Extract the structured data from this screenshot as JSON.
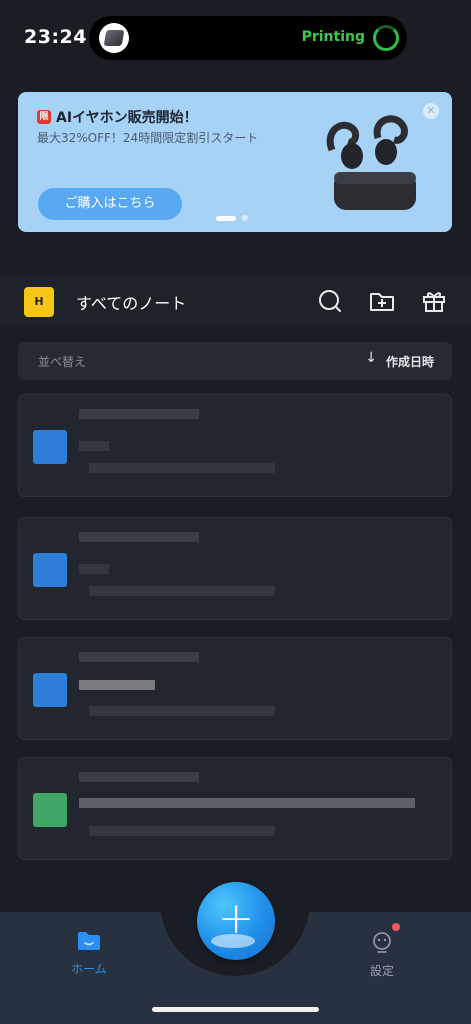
{
  "status_bar": {
    "time": "23:24",
    "live_activity_label": "Printing"
  },
  "banner": {
    "badge": "限",
    "title": "AIイヤホン販売開始！",
    "subtitle": "最大32%OFF！24時間限定割引スタート",
    "cta": "ご購入はこちら",
    "close": "✕"
  },
  "header": {
    "logo_letter": "H",
    "title": "すべてのノート"
  },
  "sort": {
    "label": "並べ替え",
    "arrow": "↓",
    "value": "作成日時"
  },
  "notes": [
    {
      "thumb_color": "#2e7fd9"
    },
    {
      "thumb_color": "#2e7fd9"
    },
    {
      "thumb_color": "#2e7fd9"
    },
    {
      "thumb_color": "#3fa866"
    }
  ],
  "bottom_nav": {
    "home_label": "ホーム",
    "settings_label": "設定",
    "fab_symbol": "+"
  },
  "colors": {
    "accent": "#2d8ef5",
    "background": "#1b1d24",
    "banner_bg": "#a6d2f5",
    "printing_green": "#3ac94a"
  }
}
